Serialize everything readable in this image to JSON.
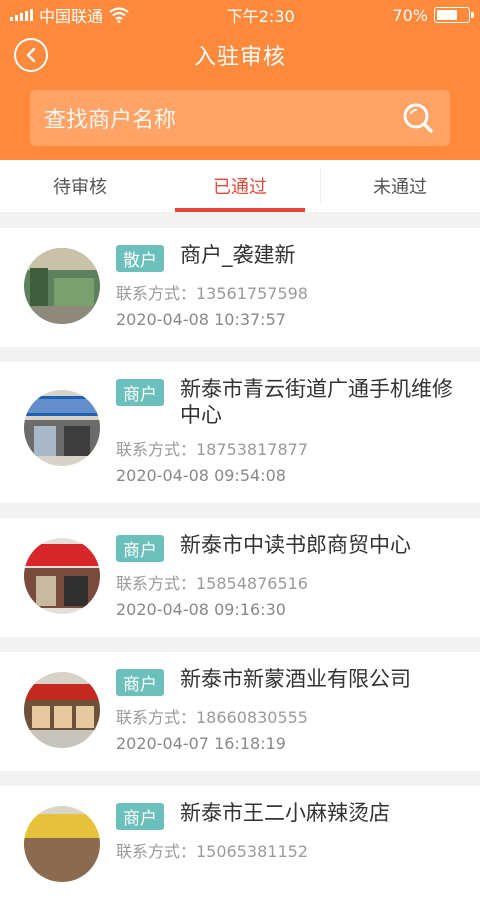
{
  "status_bar": {
    "carrier": "中国联通",
    "time": "下午2:30",
    "battery": "70%",
    "battery_level": 0.7
  },
  "header": {
    "title": "入驻审核",
    "search_placeholder": "查找商户名称"
  },
  "tabs": [
    {
      "label": "待审核",
      "active": false
    },
    {
      "label": "已通过",
      "active": true
    },
    {
      "label": "未通过",
      "active": false
    }
  ],
  "merchants": [
    {
      "badge": "散户",
      "name": "商户_袭建新",
      "contact": "联系方式：13561757598",
      "time": "2020-04-08 10:37:57"
    },
    {
      "badge": "商户",
      "name": "新泰市青云街道广通手机维修中心",
      "contact": "联系方式：18753817877",
      "time": "2020-04-08 09:54:08"
    },
    {
      "badge": "商户",
      "name": "新泰市中读书郎商贸中心",
      "contact": "联系方式：15854876516",
      "time": "2020-04-08 09:16:30"
    },
    {
      "badge": "商户",
      "name": "新泰市新蒙酒业有限公司",
      "contact": "联系方式：18660830555",
      "time": "2020-04-07 16:18:19"
    },
    {
      "badge": "商户",
      "name": "新泰市王二小麻辣烫店",
      "contact": "联系方式：15065381152",
      "time": ""
    }
  ],
  "colors": {
    "accent": "#ff8a3c",
    "tab_active": "#e34a3a",
    "badge": "#6bc0bb"
  }
}
